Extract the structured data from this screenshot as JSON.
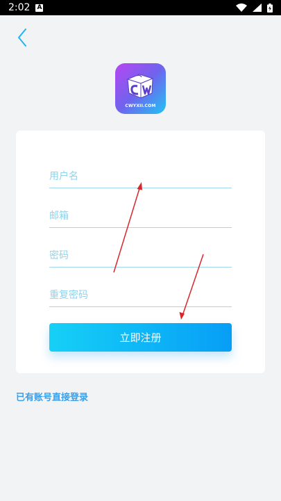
{
  "status_bar": {
    "time": "2:02",
    "notification_letter": "A"
  },
  "logo": {
    "text": "CWYXII.COM",
    "gradient": [
      "#b746f2",
      "#6f63ee",
      "#21c4f3"
    ]
  },
  "form": {
    "username_placeholder": "用户名",
    "email_placeholder": "邮箱",
    "password_placeholder": "密码",
    "confirm_password_placeholder": "重复密码",
    "register_label": "立即注册"
  },
  "login_link_label": "已有账号直接登录",
  "colors": {
    "accent": "#1aa8f5",
    "field_line": "#9ed7ee",
    "annotation_arrow": "#d8262c"
  }
}
